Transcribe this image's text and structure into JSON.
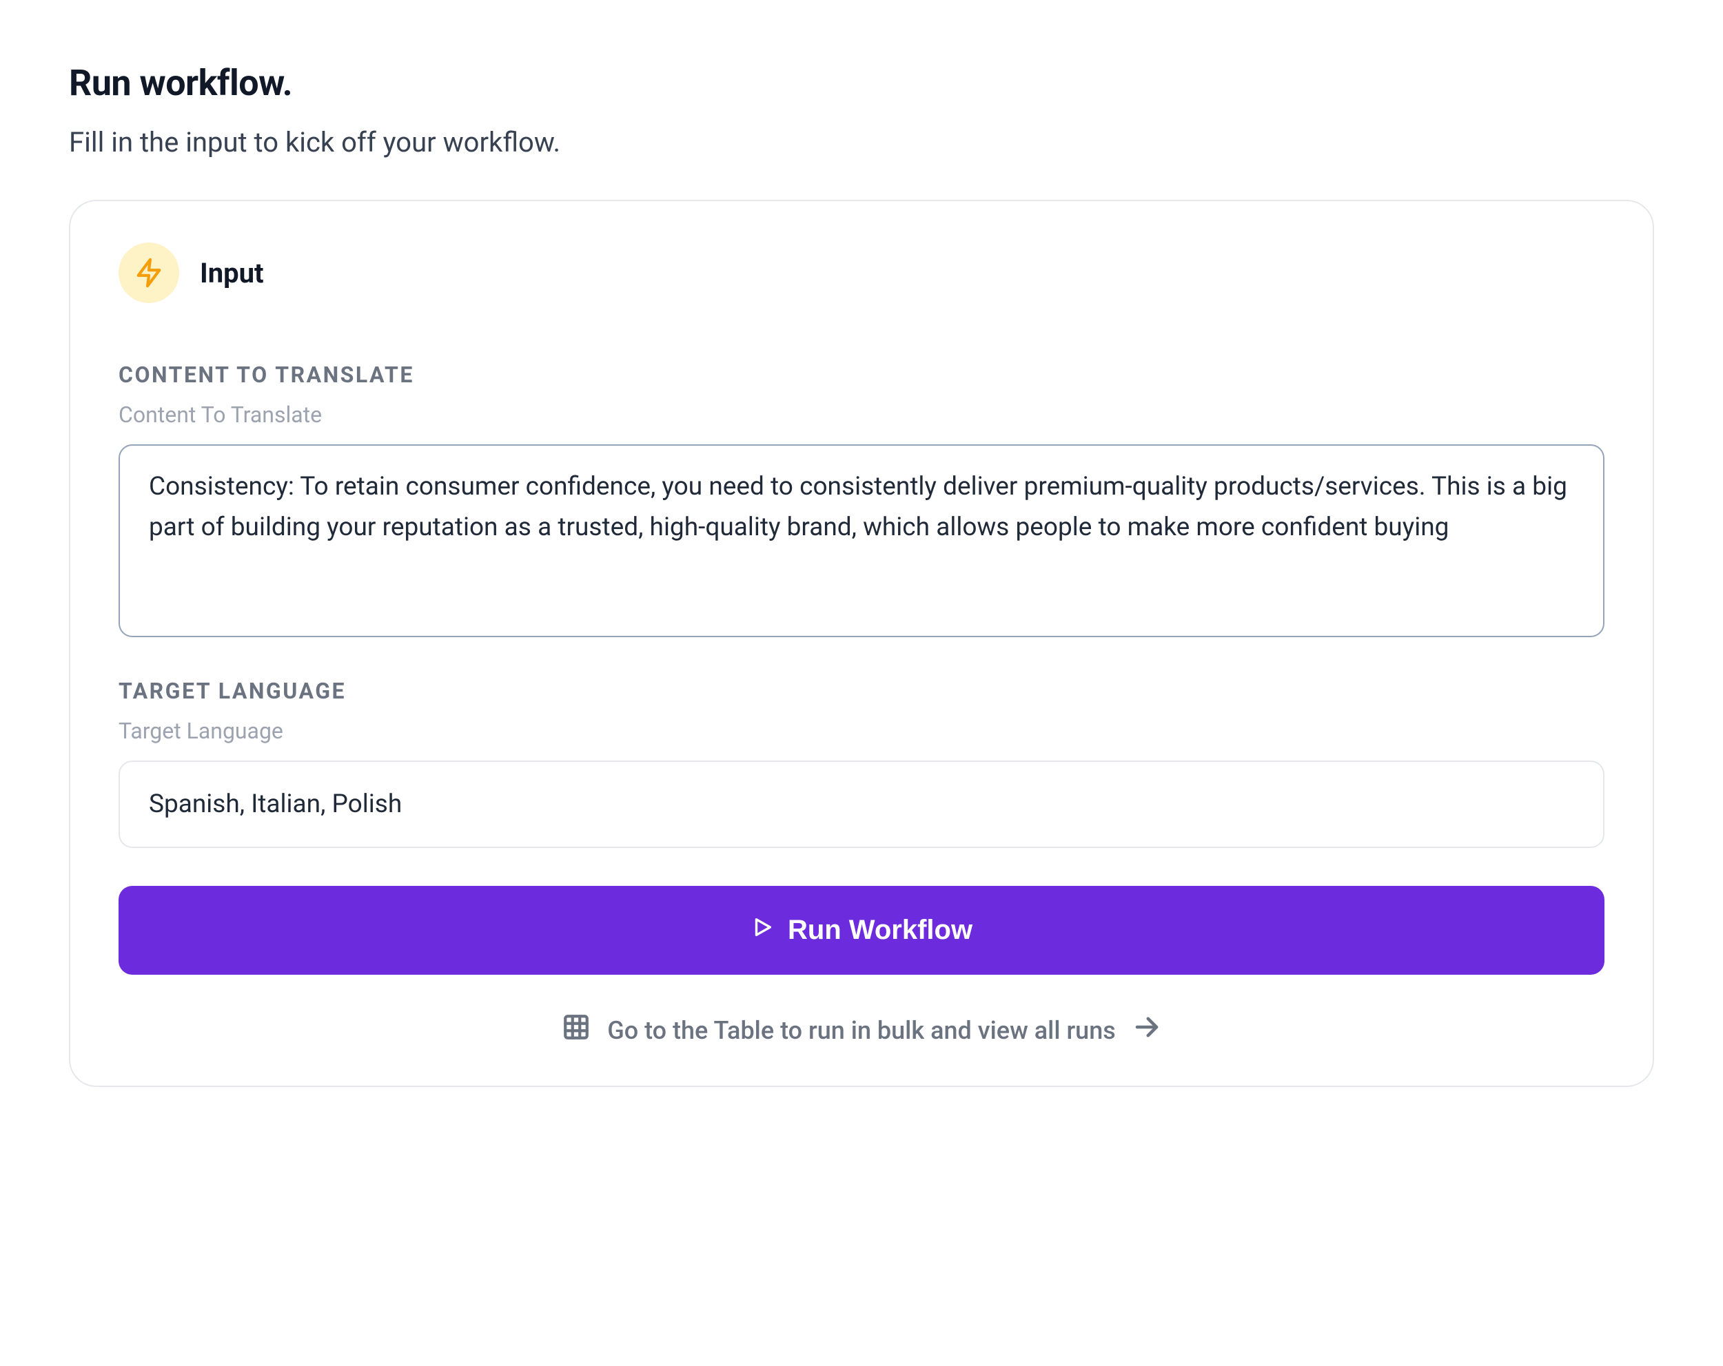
{
  "header": {
    "title": "Run workflow.",
    "subtitle": "Fill in the input to kick off your workflow."
  },
  "card": {
    "input_section_label": "Input",
    "fields": {
      "content": {
        "header": "CONTENT TO TRANSLATE",
        "sublabel": "Content To Translate",
        "value": "Consistency: To retain consumer confidence, you need to consistently deliver premium-quality products/services. This is a big part of building your reputation as a trusted, high-quality brand, which allows people to make more confident buying"
      },
      "language": {
        "header": "TARGET LANGUAGE",
        "sublabel": "Target Language",
        "value": "Spanish, Italian, Polish"
      }
    },
    "run_button_label": "Run Workflow",
    "table_link_label": "Go to the Table to run in bulk and view all runs"
  },
  "colors": {
    "accent": "#6c2cdd",
    "lightning_bg": "#fef3c7",
    "lightning_stroke": "#f59e0b",
    "border_focus": "#94a3b8",
    "border_default": "#e5e7eb",
    "text_muted": "#6b7280"
  }
}
